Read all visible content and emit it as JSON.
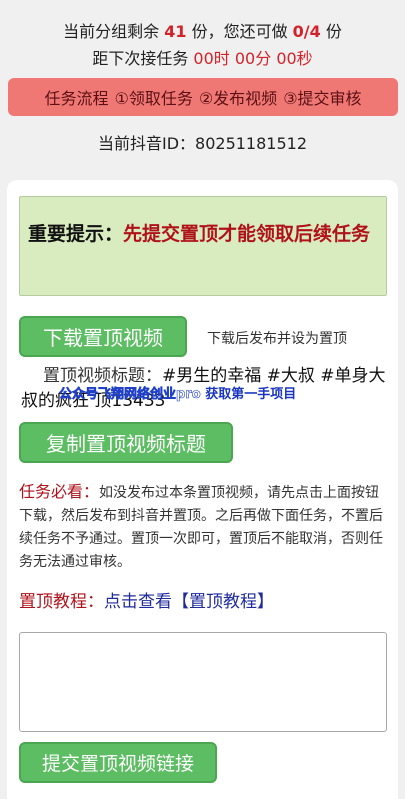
{
  "status": {
    "remaining_prefix": "当前分组剩余",
    "remaining_count": "41",
    "remaining_suffix": "份，您还可做",
    "can_do": "0/4",
    "can_do_suffix": "份",
    "next_task_label": "距下次接任务",
    "next_task_timer": "00时 00分 00秒"
  },
  "flow": {
    "label": "任务流程",
    "step1": "①领取任务",
    "step2": "②发布视频",
    "step3": "③提交审核"
  },
  "douyin": {
    "label": "当前抖音ID：",
    "id": "80251181512"
  },
  "notice": {
    "label": "重要提示：",
    "message": "先提交置顶才能领取后续任务"
  },
  "download": {
    "button": "下载置顶视频",
    "hint": "下载后发布并设为置顶"
  },
  "video_title": {
    "label": "置顶视频标题：",
    "value": "#男生的幸福 #大叔 #单身大叔的疯狂 顶13433"
  },
  "watermark": {
    "text1": "公众号飞翔网络创业pro",
    "text2": "获取第一手项目"
  },
  "copy": {
    "button": "复制置顶视频标题"
  },
  "must": {
    "label": "任务必看：",
    "text": "如没发布过本条置顶视频，请先点击上面按钮下载，然后发布到抖音并置顶。之后再做下面任务，不置后续任务不予通过。置顶一次即可，置顶后不能取消，否则任务无法通过审核。"
  },
  "tutorial": {
    "label": "置顶教程：",
    "link": "点击查看【置顶教程】"
  },
  "link_input": {
    "value": ""
  },
  "submit": {
    "button": "提交置顶视频链接"
  }
}
